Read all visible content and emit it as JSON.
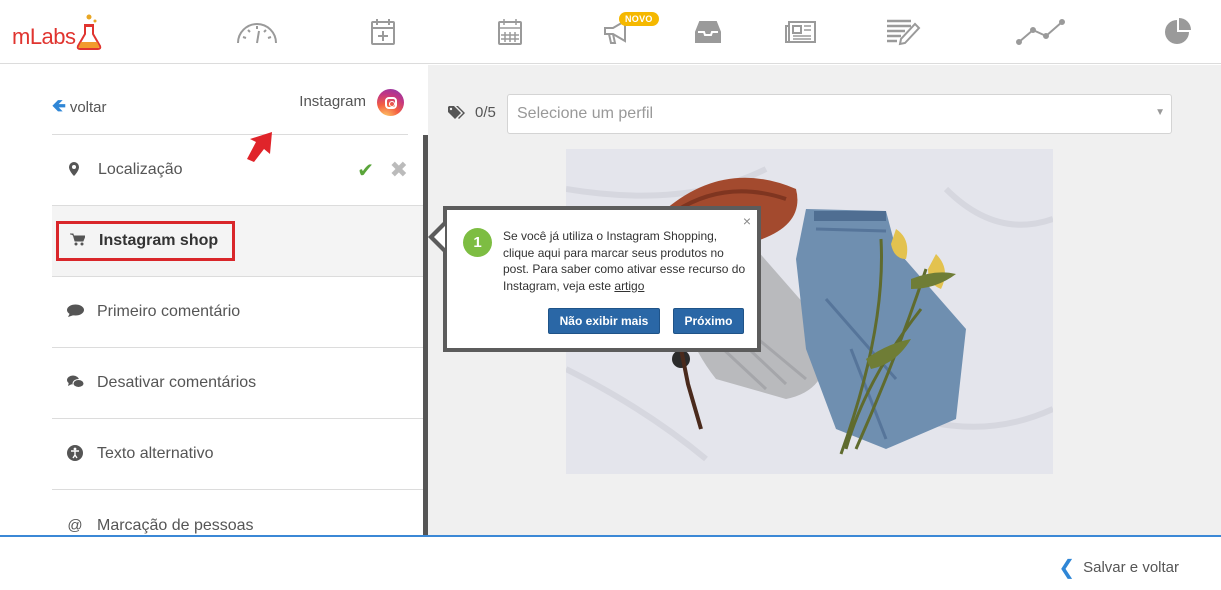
{
  "topbar": {
    "logo": "mLabs",
    "nav": [
      {
        "icon": "dashboard-gauge-icon"
      },
      {
        "icon": "calendar-add-icon"
      },
      {
        "icon": "calendar-icon"
      },
      {
        "icon": "megaphone-icon",
        "badge": "NOVO"
      },
      {
        "icon": "inbox-icon"
      },
      {
        "icon": "newspaper-icon"
      },
      {
        "icon": "edit-list-icon"
      },
      {
        "icon": "analytics-line-icon"
      },
      {
        "icon": "pie-chart-icon"
      }
    ]
  },
  "left": {
    "back_label": "voltar",
    "network_label": "Instagram",
    "menu": {
      "location": "Localização",
      "shop": "Instagram shop",
      "first_comment": "Primeiro comentário",
      "disable_comments": "Desativar comentários",
      "alt_text": "Texto alternativo",
      "tag_people": "Marcação de pessoas"
    }
  },
  "right": {
    "tag_count": "0/5",
    "profile_placeholder": "Selecione um perfil"
  },
  "tooltip": {
    "step": "1",
    "text_main": "Se você já utiliza o Instagram Shopping, clique aqui para marcar seus produtos no post. Para saber como ativar esse recurso do Instagram, veja este ",
    "text_link": "artigo",
    "btn_hide": "Não exibir mais",
    "btn_next": "Próximo",
    "close": "×"
  },
  "footer": {
    "save_back": "Salvar e voltar"
  },
  "colors": {
    "accent_blue": "#2f86d6",
    "button_blue": "#2a67a6",
    "highlight_red": "#d9262a",
    "step_green": "#7dbd42",
    "badge_yellow": "#f5b800"
  }
}
